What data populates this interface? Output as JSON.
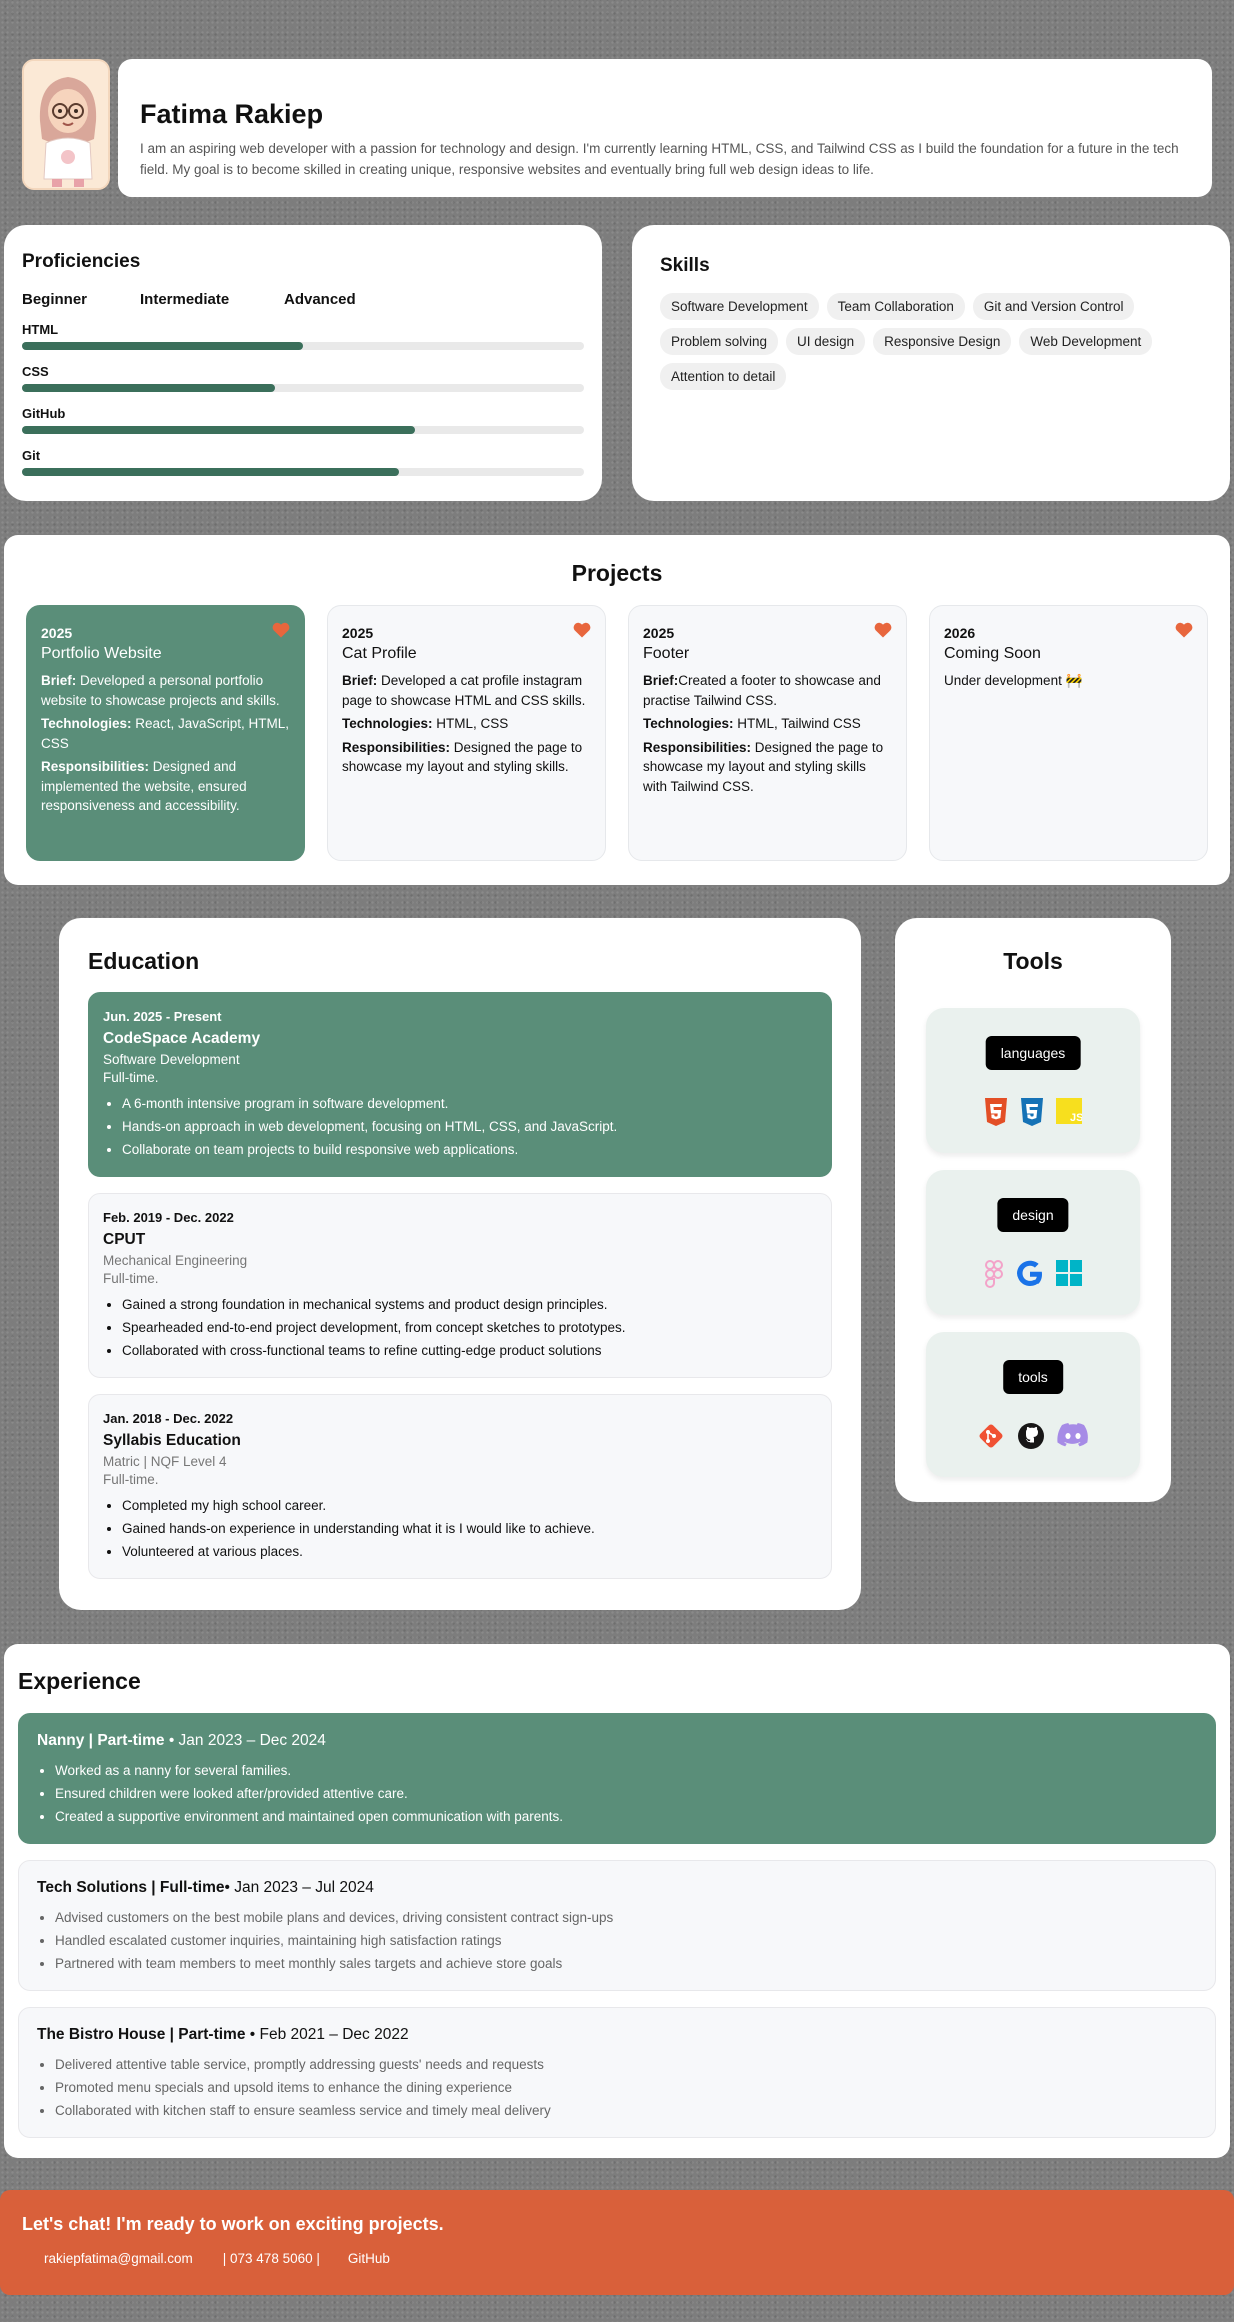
{
  "header": {
    "name": "Fatima Rakiep",
    "bio": "I am an aspiring web developer with a passion for technology and design. I'm currently learning HTML, CSS, and Tailwind CSS as I build the foundation for a future in the tech field. My goal is to become skilled in creating unique, responsive websites and eventually bring full web design ideas to life."
  },
  "proficiencies": {
    "title": "Proficiencies",
    "levels": [
      "Beginner",
      "Intermediate",
      "Advanced"
    ],
    "items": [
      {
        "label": "HTML",
        "level": 0.5
      },
      {
        "label": "CSS",
        "level": 0.45
      },
      {
        "label": "GitHub",
        "level": 0.7
      },
      {
        "label": "Git",
        "level": 0.67
      }
    ]
  },
  "skills": {
    "title": "Skills",
    "items": [
      "Software Development",
      "Team Collaboration",
      "Git and Version Control",
      "Problem solving",
      "UI design",
      "Responsive Design",
      "Web Development",
      "Attention to detail"
    ]
  },
  "projects": {
    "title": "Projects",
    "items": [
      {
        "year": "2025",
        "title": "Portfolio Website",
        "brief_label": "Brief:",
        "brief": " Developed a personal portfolio website to showcase projects and skills.",
        "tech_label": "Technologies:",
        "tech": " React, JavaScript, HTML, CSS",
        "resp_label": "Responsibilities:",
        "resp": " Designed and implemented the website, ensured responsiveness and accessibility."
      },
      {
        "year": "2025",
        "title": "Cat Profile",
        "brief_label": "Brief:",
        "brief": " Developed a cat profile instagram page to showcase HTML and CSS skills.",
        "tech_label": "Technologies:",
        "tech": " HTML, CSS",
        "resp_label": "Responsibilities:",
        "resp": " Designed the page to showcase my layout and styling skills."
      },
      {
        "year": "2025",
        "title": "Footer",
        "brief_label": "Brief:",
        "brief": "Created a footer to showcase and practise Tailwind CSS.",
        "tech_label": "Technologies:",
        "tech": " HTML, Tailwind CSS",
        "resp_label": "Responsibilities:",
        "resp": " Designed the page to showcase my layout and styling skills with Tailwind CSS."
      },
      {
        "year": "2026",
        "title": "Coming Soon",
        "note": "Under development 🚧"
      }
    ]
  },
  "education": {
    "title": "Education",
    "items": [
      {
        "date": "Jun. 2025 - Present",
        "school": "CodeSpace Academy",
        "subject": "Software Development",
        "type": "Full-time.",
        "bullets": [
          "A 6-month intensive program in software development.",
          "Hands-on approach in web development, focusing on HTML, CSS, and JavaScript.",
          "Collaborate on team projects to build responsive web applications."
        ]
      },
      {
        "date": "Feb. 2019 - Dec. 2022",
        "school": "CPUT",
        "subject": "Mechanical Engineering",
        "type": "Full-time.",
        "bullets": [
          "Gained a strong foundation in mechanical systems and product design principles.",
          "Spearheaded end-to-end project development, from concept sketches to prototypes.",
          "Collaborated with cross-functional teams to refine cutting-edge product solutions"
        ]
      },
      {
        "date": "Jan. 2018 - Dec. 2022",
        "school": "Syllabis Education",
        "subject": "Matric | NQF Level 4",
        "type": "Full-time.",
        "bullets": [
          "Completed my high school career.",
          "Gained hands-on experience in understanding what it is I would like to achieve.",
          "Volunteered at various places."
        ]
      }
    ]
  },
  "tools": {
    "title": "Tools",
    "groups": [
      {
        "label": "languages",
        "icons": [
          "html5-icon",
          "css3-icon",
          "javascript-icon"
        ]
      },
      {
        "label": "design",
        "icons": [
          "figma-icon",
          "google-icon",
          "windows-icon"
        ]
      },
      {
        "label": "tools",
        "icons": [
          "git-icon",
          "github-icon",
          "discord-icon"
        ]
      }
    ]
  },
  "experience": {
    "title": "Experience",
    "items": [
      {
        "role": "Nanny | Part-time",
        "dates": " • Jan 2023 – Dec 2024",
        "bullets": [
          "Worked as a nanny for several families.",
          "Ensured children were looked after/provided attentive care.",
          "Created a supportive environment and maintained open communication with parents."
        ]
      },
      {
        "role": "Tech Solutions | Full-time",
        "dates": "• Jan 2023 – Jul 2024",
        "bullets": [
          "Advised customers on the best mobile plans and devices, driving consistent contract sign-ups",
          "Handled escalated customer inquiries, maintaining high satisfaction ratings",
          "Partnered with team members to meet monthly sales targets and achieve store goals"
        ]
      },
      {
        "role": "The Bistro House | Part-time",
        "dates": " • Feb 2021 – Dec 2022",
        "bullets": [
          "Delivered attentive table service, promptly addressing guests' needs and requests",
          "Promoted menu specials and upsold items to enhance the dining experience",
          "Collaborated with kitchen staff to ensure seamless service and timely meal delivery"
        ]
      }
    ]
  },
  "footer": {
    "cta": "Let's chat! I'm ready to work on exciting projects.",
    "email": "rakiepfatima@gmail.com",
    "phone": "| 073 478 5060 |",
    "github": "GitHub"
  },
  "colors": {
    "accent_green": "#5a8e79",
    "bar_green": "#3b6f5b",
    "footer_orange": "#d9603a",
    "heart": "#e8663d"
  }
}
